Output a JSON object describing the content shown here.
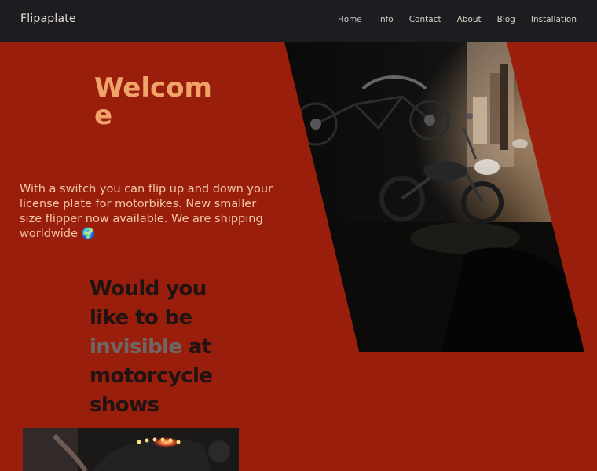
{
  "nav": {
    "brand": "Flipaplate",
    "links": [
      "Home",
      "Info",
      "Contact",
      "About",
      "Blog",
      "Installation"
    ]
  },
  "hero": {
    "welcome": "Welcome",
    "intro": "With a switch you can flip up and down your license plate for motorbikes. New smaller size flipper now available. We are shipping worldwide",
    "globe_icon": "🌍",
    "question_part1": "Would you like to be ",
    "question_highlight": "invisible",
    "question_part2": " at motorcycle shows"
  },
  "colors": {
    "background": "#9a1e0c",
    "navbar": "#1c1d20",
    "welcome": "#f0a46a",
    "intro": "#f2c8a6",
    "question": "#1f1412",
    "highlight": "#6f6766"
  }
}
